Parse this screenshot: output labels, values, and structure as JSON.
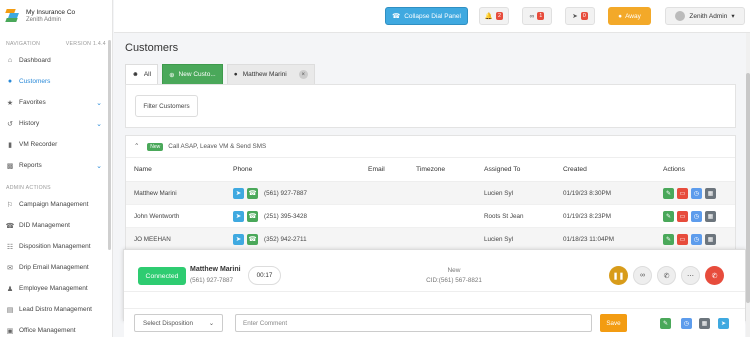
{
  "brand": {
    "name": "My Insurance Co",
    "role": "Zenith Admin"
  },
  "sidebar": {
    "nav_label": "NAVIGATION",
    "version": "VERSION 1.4.4",
    "items": [
      {
        "label": "Dashboard",
        "icon": "home-icon"
      },
      {
        "label": "Customers",
        "icon": "user-icon",
        "active": true
      },
      {
        "label": "Favorites",
        "icon": "star-icon",
        "chevron": true
      },
      {
        "label": "History",
        "icon": "history-icon",
        "chevron": true
      },
      {
        "label": "VM Recorder",
        "icon": "mic-icon"
      },
      {
        "label": "Reports",
        "icon": "chart-icon",
        "chevron": true
      }
    ],
    "admin_label": "ADMIN ACTIONS",
    "admin_items": [
      {
        "label": "Campaign Management",
        "icon": "campaign-icon"
      },
      {
        "label": "DID Management",
        "icon": "phone-icon"
      },
      {
        "label": "Disposition Management",
        "icon": "disposition-icon"
      },
      {
        "label": "Drip Email Management",
        "icon": "email-icon"
      },
      {
        "label": "Employee Management",
        "icon": "employee-icon"
      },
      {
        "label": "Lead Distro Management",
        "icon": "lead-icon"
      },
      {
        "label": "Office Management",
        "icon": "office-icon"
      }
    ]
  },
  "topbar": {
    "collapse_label": "Collapse Dial Panel",
    "notifications_count": "2",
    "voicemail_count": "1",
    "messages_count": "0",
    "away_label": "Away",
    "user_name": "Zenith Admin"
  },
  "page": {
    "title": "Customers",
    "tabs": {
      "all": "All",
      "new": "New Custo...",
      "customer": "Matthew Marini"
    },
    "filter_label": "Filter Customers"
  },
  "table": {
    "group_badge": "New",
    "group_label": "Call ASAP, Leave VM & Send SMS",
    "headers": {
      "name": "Name",
      "phone": "Phone",
      "email": "Email",
      "timezone": "Timezone",
      "assigned": "Assigned To",
      "created": "Created",
      "actions": "Actions"
    },
    "rows": [
      {
        "name": "Matthew Marini",
        "phone": "(561) 927-7887",
        "assigned": "Lucien Syl",
        "created": "01/19/23 8:30PM"
      },
      {
        "name": "John Wentworth",
        "phone": "(251) 395-3428",
        "assigned": "Roots St Jean",
        "created": "01/19/23 8:23PM"
      },
      {
        "name": "JO MEEHAN",
        "phone": "(352) 942-2711",
        "assigned": "Lucien Syl",
        "created": "01/18/23 11:04PM"
      }
    ]
  },
  "dial": {
    "status_button": "Connected",
    "name": "Matthew Marini",
    "phone": "(561) 927-7887",
    "timer": "00:17",
    "lead_status": "New",
    "cid": "CID:(561) 567-8821",
    "disposition_placeholder": "Select Disposition",
    "comment_placeholder": "Enter Comment",
    "save_label": "Save"
  },
  "colors": {
    "primary": "#3fa9e0",
    "success": "#4aa85a",
    "warning": "#f39c12",
    "danger": "#e74c3c"
  }
}
